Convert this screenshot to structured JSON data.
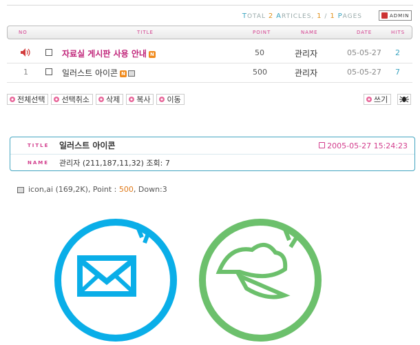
{
  "stats": {
    "total_label": "OTAL",
    "total_cap": "T",
    "total_count": "2",
    "articles_label": "RTICLES,",
    "articles_cap": "A",
    "page_current": "1",
    "page_sep": "/",
    "page_total": "1",
    "pages_label": "AGES",
    "pages_cap": "P"
  },
  "admin_button": {
    "label": "ADMIN"
  },
  "columns": {
    "no": "NO",
    "title": "TITLE",
    "point": "POINT",
    "name": "NAME",
    "date": "DATE",
    "hits": "HITS"
  },
  "rows": [
    {
      "no": "",
      "title": "자료실 게시판 사용 안내",
      "point": "50",
      "name": "관리자",
      "date": "05-05-27",
      "hits": "2"
    },
    {
      "no": "1",
      "title": "일러스트 아이콘",
      "point": "500",
      "name": "관리자",
      "date": "05-05-27",
      "hits": "7"
    }
  ],
  "actions": [
    "전체선택",
    "선택취소",
    "삭제",
    "복사",
    "이동"
  ],
  "write_button": "쓰기",
  "post": {
    "title_label": "TITLE",
    "name_label": "NAME",
    "title": "일러스트 아이콘",
    "datetime": "2005-05-27 15:24:23",
    "author": "관리자 (211,187,11,32)  조회: 7"
  },
  "attachment": {
    "filename": "icon,ai (169,2K), Point : ",
    "points": "500",
    "downloads": ", Down:3"
  },
  "colors": {
    "accent": "#d23c8c",
    "border": "#41a5c0",
    "icon_blue": "#0aaee8",
    "icon_green": "#6cc06c",
    "orange": "#e0901a"
  }
}
